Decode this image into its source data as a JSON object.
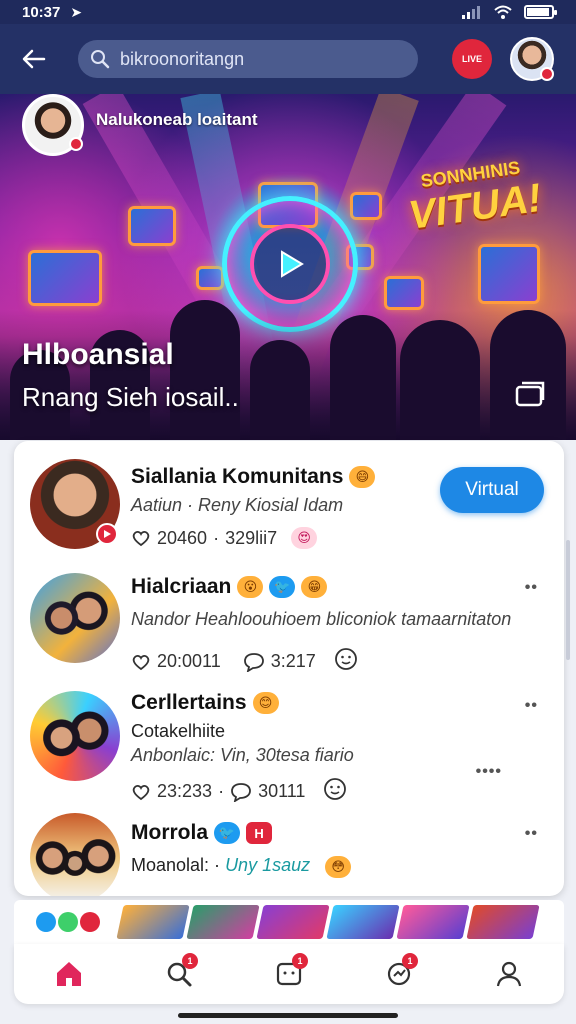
{
  "status": {
    "time": "10:37"
  },
  "appbar": {
    "search_placeholder": "bikroonoritangn",
    "live_label": "LIVE"
  },
  "hero": {
    "brand_name": "Nalukoneab loaitant",
    "sign_line1": "SONNHINIS",
    "sign_line2": "VITUA!",
    "title": "Hlboansial",
    "subtitle": "Rnang Sieh iosail.."
  },
  "list": {
    "items": [
      {
        "name": "Siallania Komunitans",
        "subtitle": "Aatiun · Reny Kiosial Idam",
        "likes": "20460",
        "comments": "329lii7",
        "action_label": "Virtual"
      },
      {
        "name": "Hialcriaan",
        "subtitle": "Nandor Heahloouhioem bliconiok tamaarnitaton",
        "likes": "20:0011",
        "comments": "3:217"
      },
      {
        "name": "Cerllertains",
        "line2": "Cotakelhiite",
        "subtitle": "Anbonlaic: Vin, 30tesa fiario",
        "likes": "23:233",
        "comments": "30111"
      },
      {
        "name": "Morrola",
        "subtitle_prefix": "Moanolal: ·",
        "subtitle_accent": "Uny 1sauz"
      }
    ]
  },
  "nav": {
    "badge": "1"
  },
  "colors": {
    "accent": "#1e88e5",
    "live_red": "#e0263c",
    "appbar": "#243166"
  }
}
